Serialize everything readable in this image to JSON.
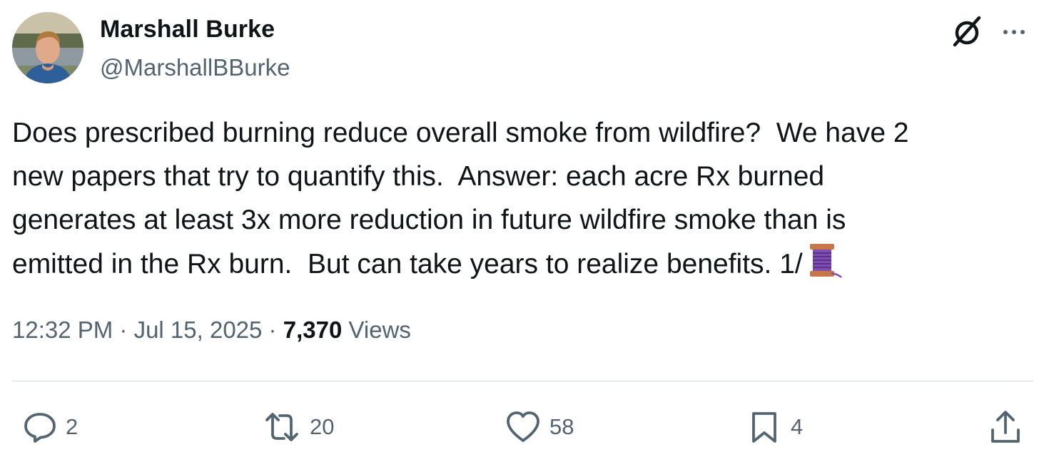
{
  "author": {
    "display_name": "Marshall Burke",
    "handle": "@MarshallBBurke",
    "avatar_icon": "profile-photo"
  },
  "tweet": {
    "text": "Does prescribed burning reduce overall smoke from wildfire?  We have 2\nnew papers that try to quantify this.  Answer: each acre Rx burned\ngenerates at least 3x more reduction in future wildfire smoke than is\nemitted in the Rx burn.  But can take years to realize benefits. 1/",
    "trailing_emoji": "thread-spool-icon"
  },
  "meta": {
    "time": "12:32 PM",
    "sep1": " · ",
    "date": "Jul 15, 2025",
    "sep2": " · ",
    "views_count": "7,370",
    "views_label": " Views"
  },
  "actions": {
    "reply_count": "2",
    "retweet_count": "20",
    "like_count": "58",
    "bookmark_count": "4"
  },
  "colors": {
    "text_primary": "#0f1419",
    "text_secondary": "#536471",
    "divider": "#cfd9de"
  }
}
